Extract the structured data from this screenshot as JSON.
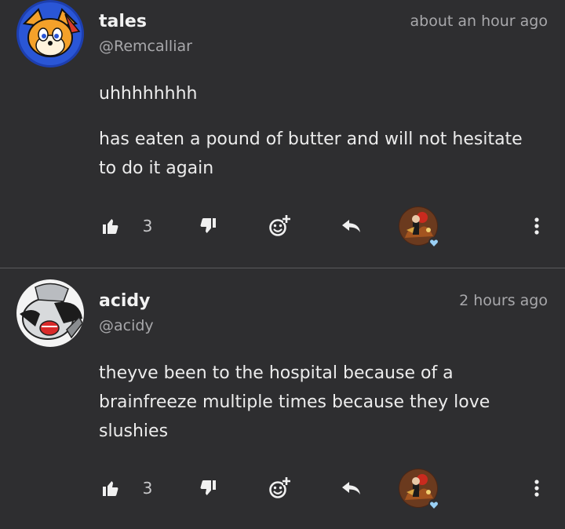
{
  "comments": [
    {
      "username": "tales",
      "handle": "@Remcalliar",
      "time": "about an hour ago",
      "paragraphs": [
        "uhhhhhhhh",
        "has eaten a pound of butter and will not hesitate to do it again"
      ],
      "like_count": "3"
    },
    {
      "username": "acidy",
      "handle": "@acidy",
      "time": "2 hours ago",
      "paragraphs": [
        "theyve been to the hospital because of a brainfreeze multiple times because they love slushies"
      ],
      "like_count": "3"
    }
  ],
  "icons": {
    "like": "thumbs-up-icon",
    "dislike": "thumbs-down-icon",
    "react": "add-reaction-icon",
    "reply": "reply-icon",
    "more": "more-vertical-icon",
    "reactor_badge": "heart-icon"
  },
  "colors": {
    "background": "#2e2e30",
    "text": "#ececec",
    "muted": "#a8a8ab",
    "divider": "#5a5a5c",
    "heart": "#9ad0f5"
  }
}
